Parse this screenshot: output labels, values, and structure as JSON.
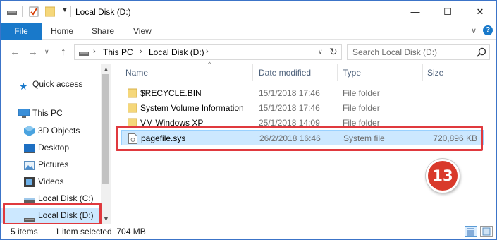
{
  "window": {
    "title": "Local Disk (D:)",
    "controls": {
      "minimize": "—",
      "maximize": "☐",
      "close": "✕"
    }
  },
  "ribbon": {
    "tabs": [
      {
        "label": "File",
        "active": true
      },
      {
        "label": "Home"
      },
      {
        "label": "Share"
      },
      {
        "label": "View"
      }
    ]
  },
  "address": {
    "crumbs": [
      "This PC",
      "Local Disk (D:)"
    ],
    "search_placeholder": "Search Local Disk (D:)"
  },
  "nav": {
    "items": [
      {
        "label": "Quick access",
        "icon": "star-icon"
      },
      {
        "label": "This PC",
        "icon": "computer-icon"
      },
      {
        "label": "3D Objects",
        "icon": "cube-icon"
      },
      {
        "label": "Desktop",
        "icon": "desktop-icon"
      },
      {
        "label": "Pictures",
        "icon": "pictures-icon"
      },
      {
        "label": "Videos",
        "icon": "videos-icon"
      },
      {
        "label": "Local Disk (C:)",
        "icon": "drive-icon"
      },
      {
        "label": "Local Disk (D:)",
        "icon": "drive-icon",
        "selected": true
      }
    ]
  },
  "columns": {
    "name": "Name",
    "date": "Date modified",
    "type": "Type",
    "size": "Size"
  },
  "files": [
    {
      "name": "$RECYCLE.BIN",
      "date": "15/1/2018 17:46",
      "type": "File folder",
      "size": "",
      "icon": "folder-icon"
    },
    {
      "name": "System Volume Information",
      "date": "15/1/2018 17:46",
      "type": "File folder",
      "size": "",
      "icon": "folder-icon"
    },
    {
      "name": "VM Windows XP",
      "date": "25/1/2018 14:09",
      "type": "File folder",
      "size": "",
      "icon": "folder-icon"
    },
    {
      "name": "pagefile.sys",
      "date": "26/2/2018 16:46",
      "type": "System file",
      "size": "720,896 KB",
      "icon": "system-file-icon",
      "selected": true
    }
  ],
  "status": {
    "count": "5 items",
    "selection": "1 item selected  704 MB"
  },
  "annotation": {
    "step": "13"
  },
  "colors": {
    "accent": "#1979ca",
    "selection": "#cce8ff",
    "highlight": "#e0393e",
    "badge": "#d93a2b"
  }
}
